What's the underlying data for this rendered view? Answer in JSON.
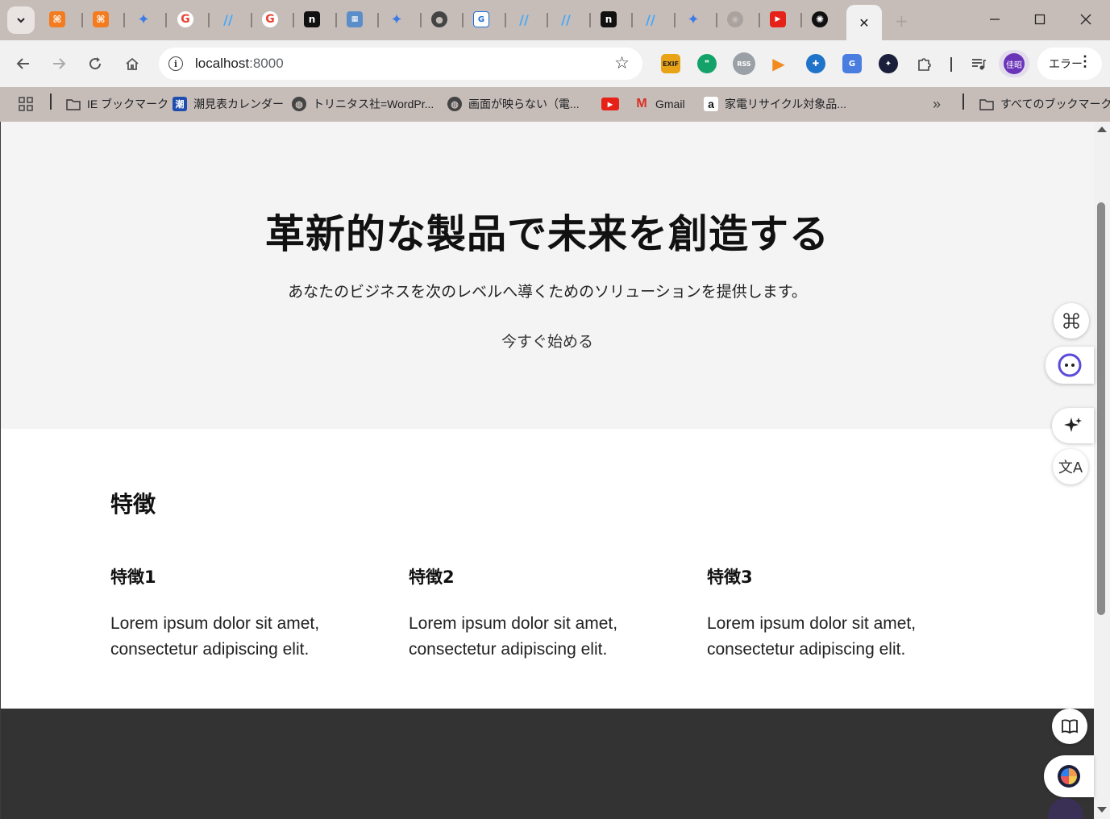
{
  "browser": {
    "tabs": [
      {
        "icon": "xampp-icon"
      },
      {
        "icon": "xampp-icon"
      },
      {
        "icon": "gemini-icon"
      },
      {
        "icon": "google-icon"
      },
      {
        "icon": "zenn-icon"
      },
      {
        "icon": "google-icon"
      },
      {
        "icon": "notion-icon"
      },
      {
        "icon": "site-icon"
      },
      {
        "icon": "gemini-icon"
      },
      {
        "icon": "github-icon"
      },
      {
        "icon": "converter-icon"
      },
      {
        "icon": "zenn-icon"
      },
      {
        "icon": "zenn-icon"
      },
      {
        "icon": "notion-icon"
      },
      {
        "icon": "zenn-icon"
      },
      {
        "icon": "gemini-icon"
      },
      {
        "icon": "chrome-icon"
      },
      {
        "icon": "youtube-icon"
      },
      {
        "icon": "chatgpt-icon"
      }
    ],
    "active_tab_close": "✕",
    "new_tab": "+",
    "url_host": "localhost",
    "url_port": ":8000",
    "profile_initials": "佳昭",
    "error_button_label": "エラー",
    "extensions": [
      {
        "name": "exif-icon",
        "label": "EXIF",
        "color": "#e8a317"
      },
      {
        "name": "quote-icon",
        "label": "❞",
        "color": "#13a36a"
      },
      {
        "name": "rss-icon",
        "label": "RSS",
        "color": "#9aa0a6"
      },
      {
        "name": "play-icon",
        "label": "▶",
        "color": "#f28b1e"
      },
      {
        "name": "plus-circle-icon",
        "label": "✚",
        "color": "#1f73c9"
      },
      {
        "name": "translate-icon",
        "label": "G",
        "color": "#4a7de0"
      },
      {
        "name": "star-orb-icon",
        "label": "✦",
        "color": "#1b1f3b"
      }
    ]
  },
  "bookmarks": [
    {
      "label": "IE ブックマーク",
      "icon": "folder-icon"
    },
    {
      "label": "潮見表カレンダー",
      "icon": "tide-icon"
    },
    {
      "label": "トリニタス社=WordPr...",
      "icon": "globe-icon"
    },
    {
      "label": "画面が映らない（電...",
      "icon": "globe-icon"
    },
    {
      "label": "",
      "icon": "youtube-icon"
    },
    {
      "label": "Gmail",
      "icon": "gmail-icon"
    },
    {
      "label": "家電リサイクル対象品...",
      "icon": "amazon-icon"
    }
  ],
  "bookmarks_overflow": "»",
  "all_bookmarks": "すべてのブックマーク",
  "hero": {
    "title": "革新的な製品で未来を創造する",
    "subtitle": "あなたのビジネスを次のレベルへ導くためのソリューションを提供します。",
    "cta": "今すぐ始める"
  },
  "features": {
    "heading": "特徴",
    "items": [
      {
        "title": "特徴1",
        "text": "Lorem ipsum dolor sit amet, consectetur adipiscing elit."
      },
      {
        "title": "特徴2",
        "text": "Lorem ipsum dolor sit amet, consectetur adipiscing elit."
      },
      {
        "title": "特徴3",
        "text": "Lorem ipsum dolor sit amet, consectetur adipiscing elit."
      }
    ]
  },
  "colors": {
    "hero_bg": "#f4f4f4",
    "footer_bg": "#333333",
    "tabstrip_bg": "#c6bdb9"
  }
}
